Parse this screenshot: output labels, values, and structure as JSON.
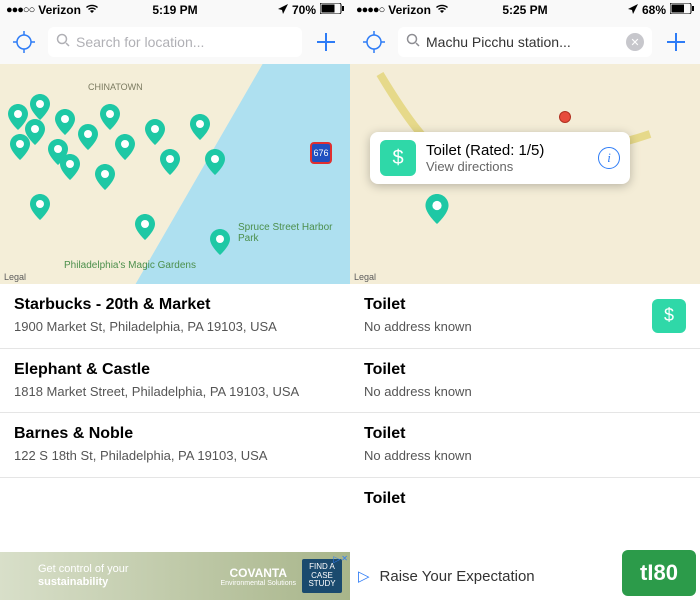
{
  "left": {
    "status": {
      "carrier": "Verizon",
      "time": "5:19 PM",
      "battery": "70%"
    },
    "search": {
      "placeholder": "Search for location..."
    },
    "map": {
      "legal": "Legal",
      "hwy": "676",
      "labels": [
        "CHINATOWN",
        "Spruce Street Harbor Park",
        "Philadelphia's Magic Gardens"
      ]
    },
    "results": [
      {
        "title": "Starbucks - 20th & Market",
        "address": "1900 Market St, Philadelphia, PA 19103, USA"
      },
      {
        "title": "Elephant & Castle",
        "address": "1818 Market Street, Philadelphia, PA 19103, USA"
      },
      {
        "title": "Barnes & Noble",
        "address": "122 S 18th St, Philadelphia, PA 19103, USA"
      }
    ],
    "ad": {
      "t1": "Get control of your",
      "t2": "sustainability",
      "brand": "COVANTA",
      "sub": "Environmental Solutions",
      "cta": "FIND A CASE STUDY"
    }
  },
  "right": {
    "status": {
      "carrier": "Verizon",
      "time": "5:25 PM",
      "battery": "68%"
    },
    "search": {
      "value": "Machu Picchu station..."
    },
    "map": {
      "legal": "Legal"
    },
    "callout": {
      "title": "Toilet (Rated: 1/5)",
      "sub": "View directions"
    },
    "results": [
      {
        "title": "Toilet",
        "address": "No address known",
        "paid": true
      },
      {
        "title": "Toilet",
        "address": "No address known",
        "paid": false
      },
      {
        "title": "Toilet",
        "address": "No address known",
        "paid": false
      },
      {
        "title": "Toilet",
        "address": "",
        "paid": false
      }
    ],
    "ad": {
      "text": "Raise Your Expectation"
    }
  },
  "watermark": "tI80"
}
